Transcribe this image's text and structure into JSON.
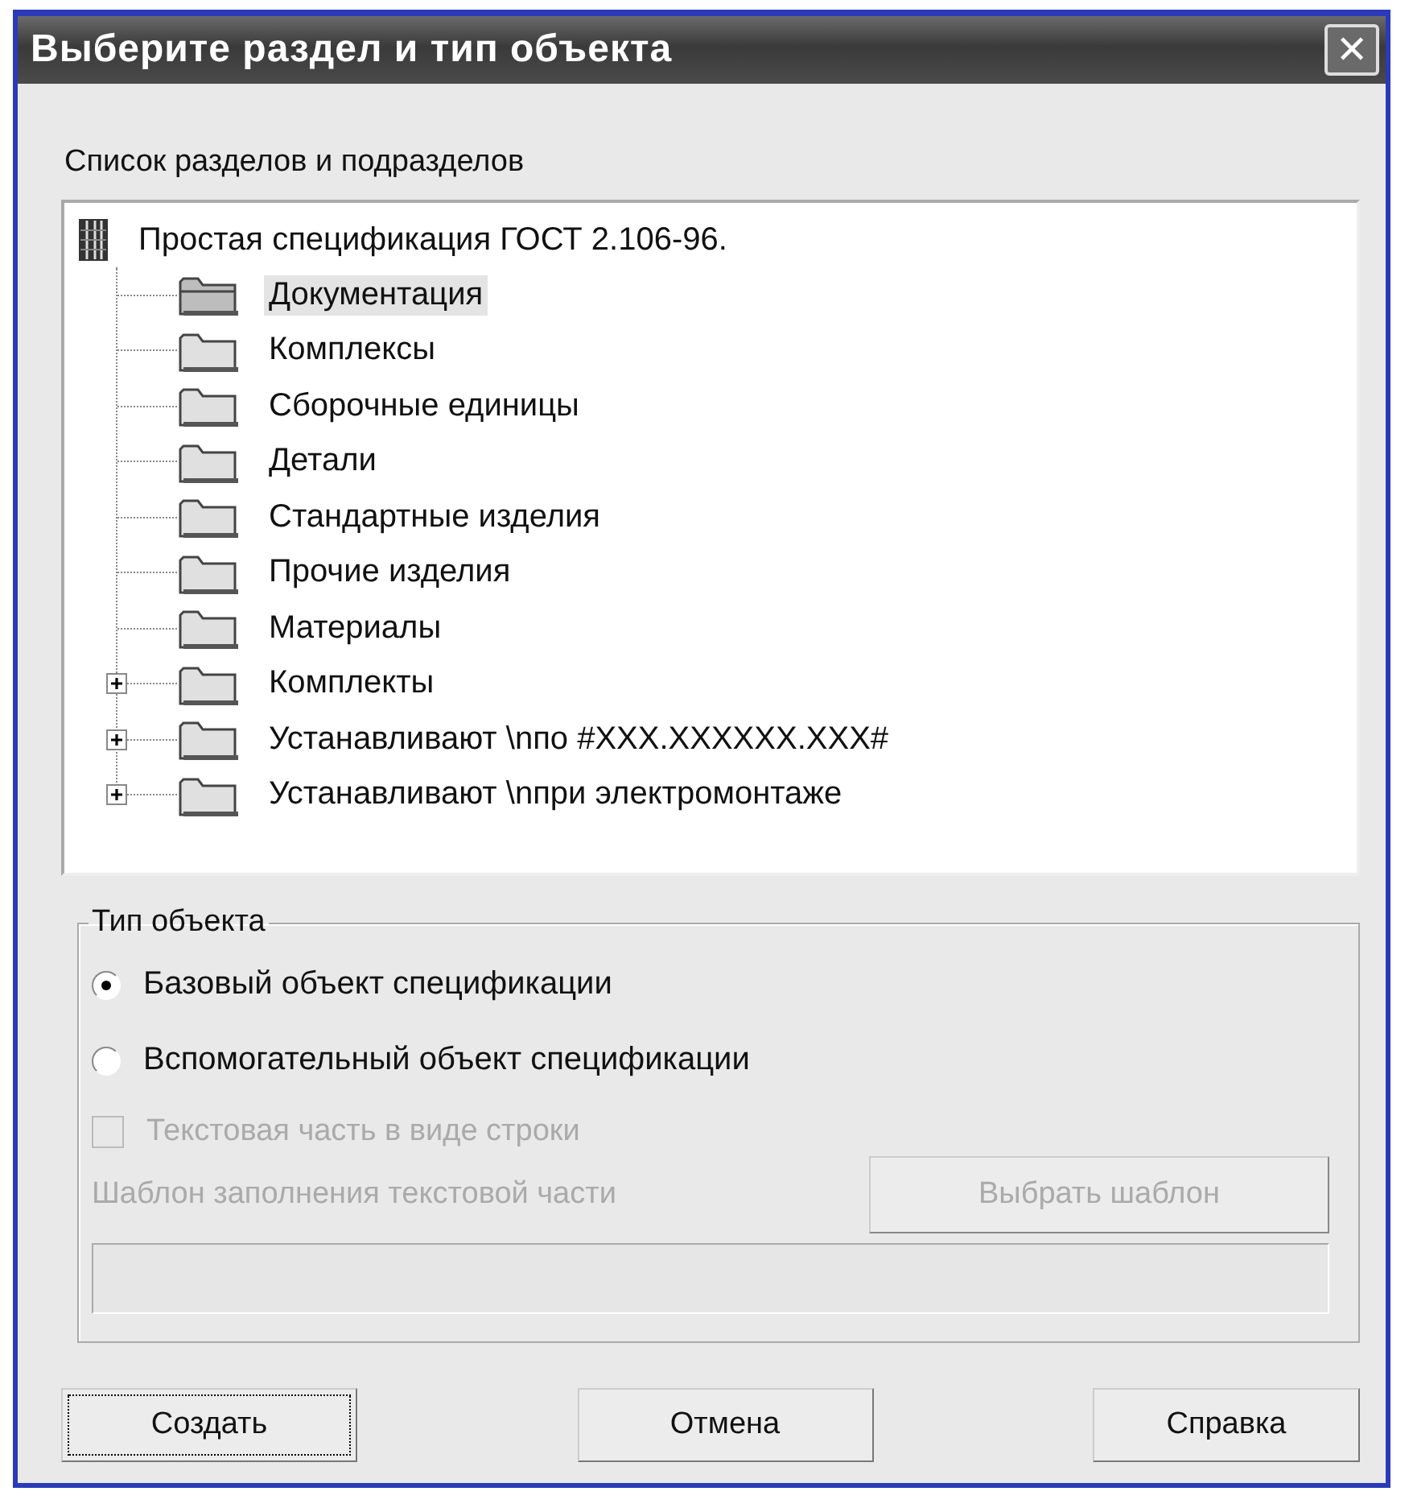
{
  "window": {
    "title": "Выберите раздел и тип объекта",
    "close": "✕"
  },
  "tree": {
    "label": "Список разделов и подразделов",
    "root": {
      "text": "Простая спецификация ГОСТ 2.106-96.",
      "children": [
        {
          "text": "Документация",
          "selected": true,
          "collapsed": false
        },
        {
          "text": "Комплексы",
          "selected": false,
          "collapsed": false
        },
        {
          "text": "Сборочные единицы",
          "selected": false,
          "collapsed": false
        },
        {
          "text": "Детали",
          "selected": false,
          "collapsed": false
        },
        {
          "text": "Стандартные изделия",
          "selected": false,
          "collapsed": false
        },
        {
          "text": "Прочие изделия",
          "selected": false,
          "collapsed": false
        },
        {
          "text": "Материалы",
          "selected": false,
          "collapsed": false
        },
        {
          "text": "Комплекты",
          "selected": false,
          "collapsed": true
        },
        {
          "text": "Устанавливают \\nпо #XXX.XXXXXX.XXX#",
          "selected": false,
          "collapsed": true
        },
        {
          "text": "Устанавливают \\nпри электромонтаже",
          "selected": false,
          "collapsed": true
        }
      ]
    }
  },
  "object_type": {
    "legend": "Тип объекта",
    "options": [
      {
        "label": "Базовый объект спецификации",
        "selected": true
      },
      {
        "label": "Вспомогательный объект спецификации",
        "selected": false
      }
    ],
    "text_as_line": {
      "label": "Текстовая часть в виде строки",
      "checked": false,
      "disabled": true
    },
    "template_label": {
      "text": "Шаблон заполнения текстовой части",
      "disabled": true
    },
    "template_button": {
      "label": "Выбрать шаблон",
      "disabled": true
    },
    "template_field": {
      "disabled": true
    }
  },
  "buttons": [
    {
      "label": "Создать",
      "focused": true
    },
    {
      "label": "Отмена",
      "focused": false
    },
    {
      "label": "Справка",
      "focused": false
    }
  ]
}
